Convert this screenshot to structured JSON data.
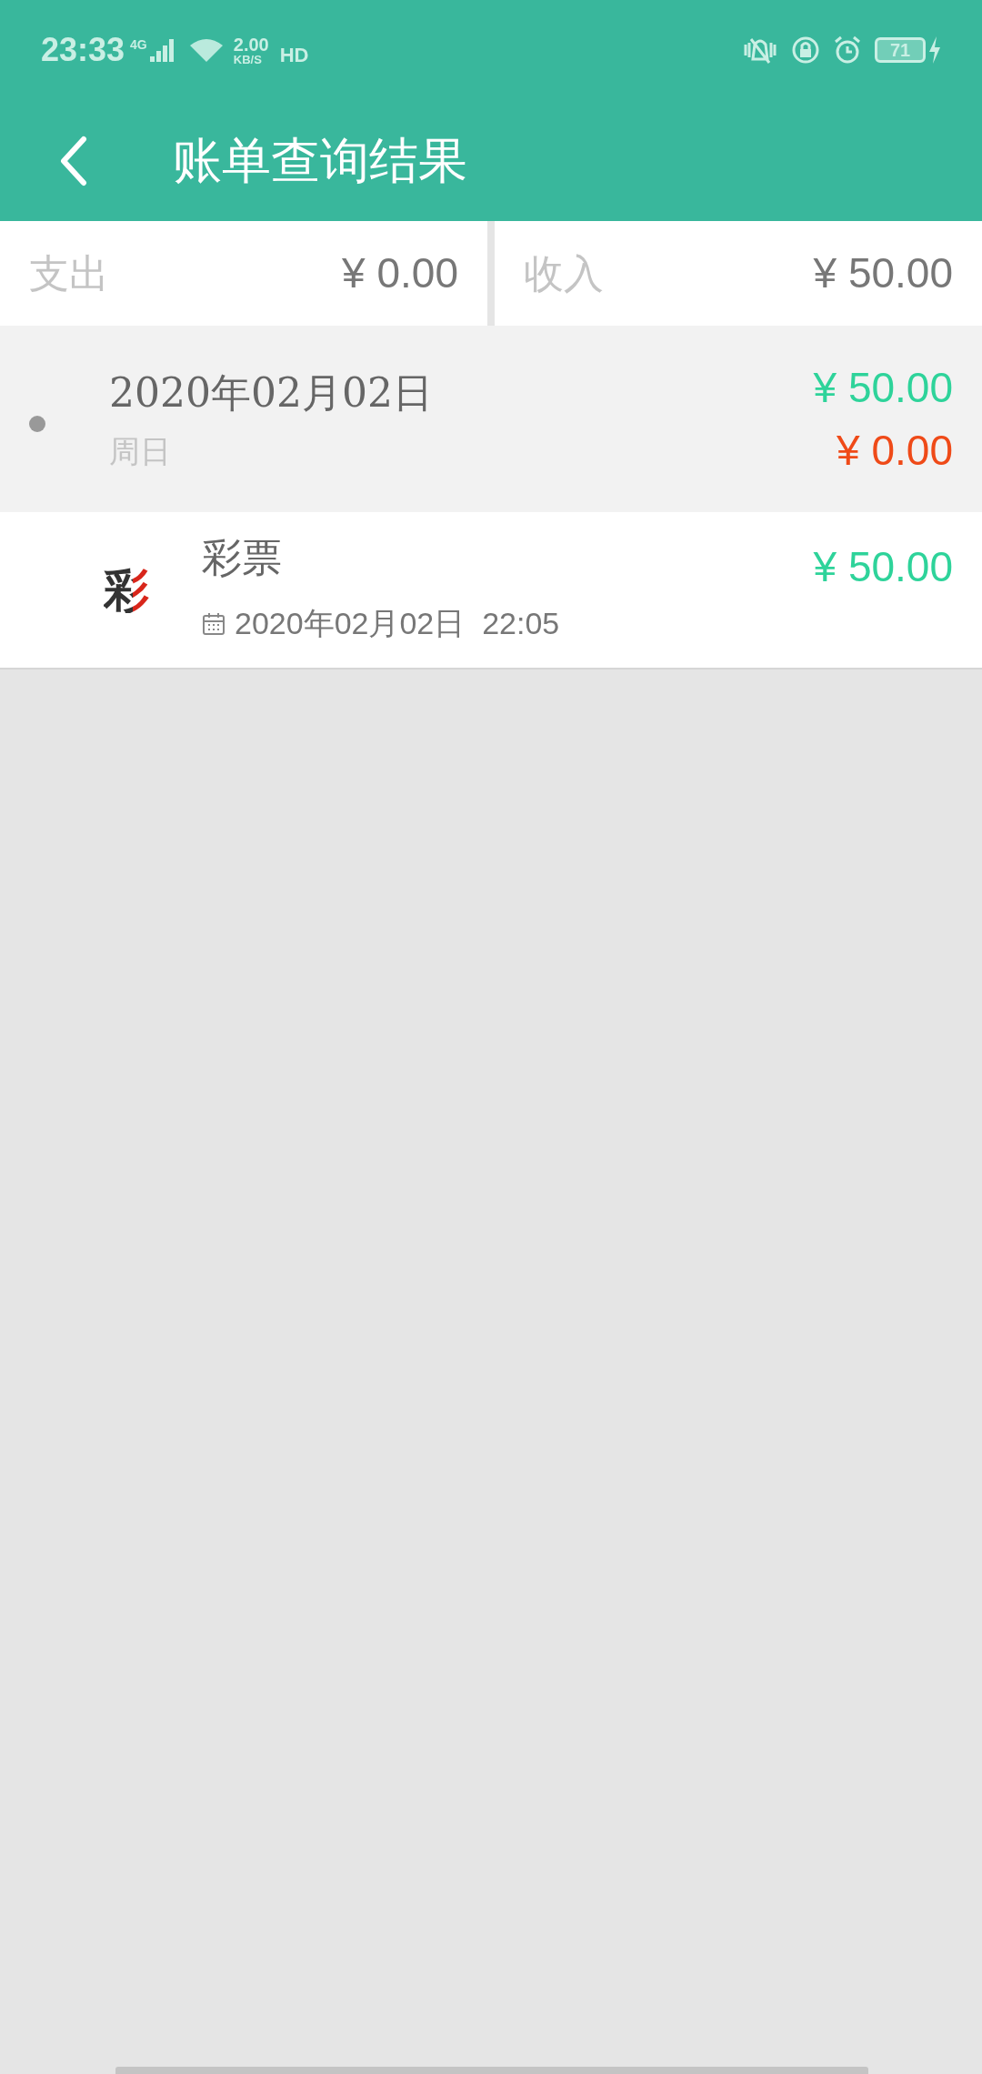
{
  "status_bar": {
    "time": "23:33",
    "network": "4G",
    "speed": "2.00",
    "speed_unit": "KB/S",
    "hd": "HD",
    "battery": "71"
  },
  "header": {
    "title": "账单查询结果"
  },
  "summary": [
    {
      "label": "支出",
      "amount": "¥ 0.00"
    },
    {
      "label": "收入",
      "amount": "¥ 50.00"
    }
  ],
  "days": [
    {
      "date": "2020年02月02日",
      "weekday": "周日",
      "income": "¥ 50.00",
      "expense": "¥ 0.00",
      "entries": [
        {
          "icon_char": "彩",
          "name": "彩票",
          "time": "2020年02月02日  22:05",
          "amount": "¥ 50.00"
        }
      ]
    }
  ]
}
